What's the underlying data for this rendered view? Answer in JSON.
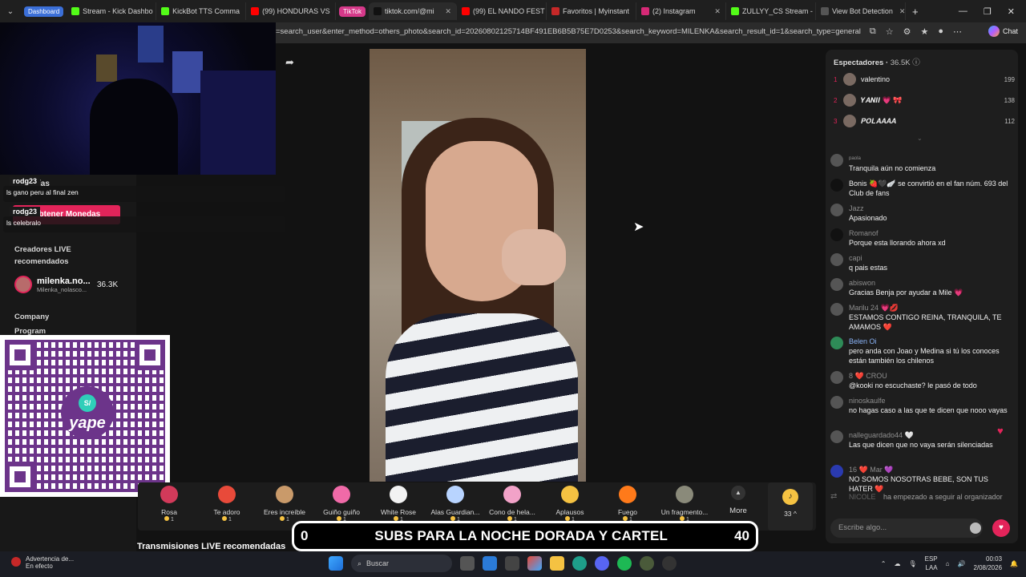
{
  "tabs": [
    {
      "label": "Dashboard",
      "group": true,
      "color": "#3b6fd8"
    },
    {
      "label": "Stream - Kick Dashbo",
      "fav": "#53fc18"
    },
    {
      "label": "KickBot TTS Comma",
      "fav": "#53fc18"
    },
    {
      "label": "(99) HONDURAS VS",
      "fav": "#ff0000"
    },
    {
      "label": "TikTok",
      "group": true,
      "color": "#d6398a"
    },
    {
      "label": "tiktok.com/@mi",
      "fav": "#111111",
      "active": true
    },
    {
      "label": "(99) EL NANDO FEST",
      "fav": "#ff0000"
    },
    {
      "label": "Favoritos | Myinstant",
      "fav": "#c62828"
    },
    {
      "label": "(2) Instagram",
      "fav": "#d62976"
    },
    {
      "label": "ZULLYY_CS Stream -",
      "fav": "#53fc18"
    },
    {
      "label": "View Bot Detection",
      "fav": "#555555"
    }
  ],
  "address": {
    "url": "=search_user&enter_method=others_photo&search_id=20260802125714BF491EB6B5B75E7D0253&search_keyword=MILENKA&search_result_id=1&search_type=general",
    "chat_label": "Chat"
  },
  "overlay_chat": [
    {
      "user": "rodg23",
      "text": "ls gano peru al final zen"
    },
    {
      "user": "rodg23",
      "text": "ls celebralo"
    }
  ],
  "leftnav": {
    "coins_button": "Obtener Monedas",
    "hidden_label": "ías",
    "recommended_title": "Creadores LIVE recomendados",
    "creator_name": "milenka.no...",
    "creator_handle": "Milenka_nolasco...",
    "creator_count": "36.3K",
    "company": "Company",
    "program": "Program"
  },
  "qr": {
    "brand": "yape",
    "badge": "S/"
  },
  "gifts": [
    {
      "name": "Rosa",
      "price": "1",
      "color": "#d23a5a"
    },
    {
      "name": "Te adoro",
      "price": "1",
      "color": "#e84a3a"
    },
    {
      "name": "Eres increíble",
      "price": "1",
      "color": "#c99a6a"
    },
    {
      "name": "Guiño guiño",
      "price": "1",
      "color": "#f06aa8"
    },
    {
      "name": "White Rose",
      "price": "1",
      "color": "#f2f2f2"
    },
    {
      "name": "Alas Guardian...",
      "price": "1",
      "color": "#b8d4ff"
    },
    {
      "name": "Cono de hela...",
      "price": "1",
      "color": "#f2a2c8"
    },
    {
      "name": "Aplausos",
      "price": "1",
      "color": "#f5c242"
    },
    {
      "name": "Fuego",
      "price": "1",
      "color": "#ff7a1a"
    },
    {
      "name": "Un fragmento...",
      "price": "1",
      "color": "#8a8a7a"
    }
  ],
  "more_label": "More",
  "coins_balance": "33",
  "banner": {
    "left": "0",
    "title": "SUBS PARA LA NOCHE DORADA Y CARTEL",
    "right": "40"
  },
  "recommended_streams": "Transmisiones LIVE recomendadas",
  "viewers": {
    "title": "Espectadores",
    "count": "36.5K"
  },
  "ranking": [
    {
      "rank": "1",
      "name": "valentino",
      "value": "199"
    },
    {
      "rank": "2",
      "name": "𝒀𝑨𝑵𝑰𝑰 💗 🎀",
      "value": "138"
    },
    {
      "rank": "3",
      "name": "𝑷𝑶𝑳𝑨𝑨𝑨𝑨",
      "value": "112"
    }
  ],
  "messages": [
    {
      "user": "ᵖᵃᵒˡᵃ",
      "text": "Tranquila aún no comienza"
    },
    {
      "user": "",
      "text": "Bonis 🍓🖤🪽 se convirtió en el fan núm. 693 del Club de fans",
      "inline": true
    },
    {
      "user": "Jazz",
      "text": "Apasionado"
    },
    {
      "user": "Romanof",
      "text": "Porque esta llorando ahora xd"
    },
    {
      "user": "capi",
      "text": "q pais estas"
    },
    {
      "user": "abiswon",
      "text": "Gracias Benja por ayudar a Mile 💗"
    },
    {
      "user": "Marilu 24 💗💋",
      "text": "ESTAMOS CONTIGO REINA, TRANQUILA, TE AMAMOS ❤️"
    },
    {
      "user": "Belen Oi",
      "text": "pero anda con Joao y Medina si tú los conoces están también los chilenos"
    },
    {
      "user": "8 ❤️ CROU",
      "text": "@kooki no escuchaste? le pasó de todo"
    },
    {
      "user": "ninoskaulfe",
      "text": "no hagas caso a las que te dicen que nooo vayas"
    },
    {
      "user": "nalleguardado44 🤍",
      "text": "Las que dicen que no vaya serán silenciadas"
    },
    {
      "user": "16 ❤️ Mar 💜",
      "text": "NO SOMOS NOSOTRAS BEBE, SON TUS HATER ❤️"
    },
    {
      "user": "NICOLE",
      "text": "ha empezado a seguir al organizador",
      "inline": true
    }
  ],
  "chat_placeholder": "Escribe algo...",
  "taskbar": {
    "warning_title": "Advertencia de...",
    "warning_sub": "En efecto",
    "search": "Buscar",
    "lang": "ESP",
    "lang2": "LAA",
    "time": "00:03",
    "date": "2/08/2026"
  }
}
